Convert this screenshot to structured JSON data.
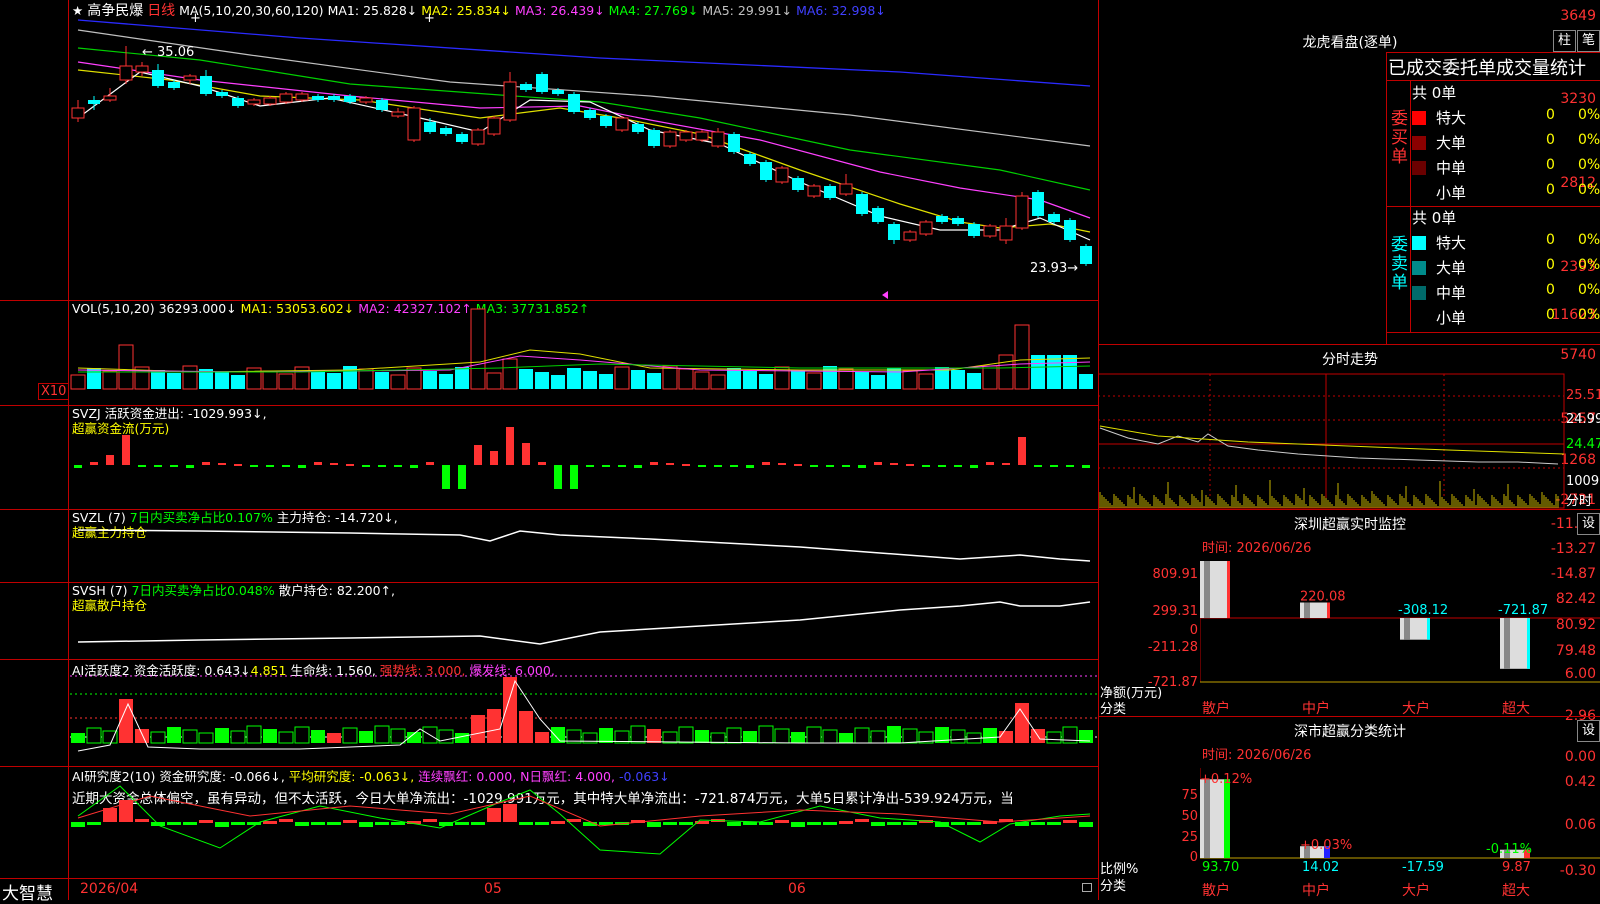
{
  "stock": {
    "star": "★",
    "name": "高争民爆",
    "period": "日线"
  },
  "ma_header": {
    "params": "MA(5,10,20,30,60,120)",
    "ma1_label": "MA1:",
    "ma1": "25.828↓",
    "ma2_label": "MA2:",
    "ma2": "25.834↓",
    "ma3_label": "MA3:",
    "ma3": "26.439↓",
    "ma4_label": "MA4:",
    "ma4": "27.769↓",
    "ma5_label": "MA5:",
    "ma5": "29.991↓",
    "ma6_label": "MA6:",
    "ma6": "32.998↓"
  },
  "price_axis": [
    "3649",
    "3230",
    "2812",
    "2393"
  ],
  "price_marks": {
    "high": "35.06",
    "low": "23.93"
  },
  "vol_header": {
    "params": "VOL(5,10,20)",
    "vol": "36293.000↓",
    "ma1_label": "MA1:",
    "ma1": "53053.602↓",
    "ma2_label": "MA2:",
    "ma2": "42327.102↑",
    "ma3_label": "MA3:",
    "ma3": "37731.852↑"
  },
  "vol_axis": [
    "11623",
    "5740"
  ],
  "vol_unit": "X10",
  "svzj": {
    "name": "SVZJ",
    "label": "活跃资金进出:",
    "value": "-1029.993↓,",
    "subtitle": "超赢资金流(万元)"
  },
  "svzj_axis": [
    "5257",
    "1268",
    "-2721"
  ],
  "svzl": {
    "name": "SVZL",
    "param": "(7)",
    "desc": "7日内买卖净占比0.107%",
    "label": "主力持仓:",
    "value": "-14.720↓,",
    "subtitle": "超赢主力持仓"
  },
  "svzl_axis": [
    "-11.68",
    "-13.27",
    "-14.87"
  ],
  "svsh": {
    "name": "SVSH",
    "param": "(7)",
    "desc": "7日内买卖净占比0.048%",
    "label": "散户持仓:",
    "value": "82.200↑,",
    "subtitle": "超赢散户持仓"
  },
  "svsh_axis": [
    "82.42",
    "80.92",
    "79.48"
  ],
  "ai_active": {
    "name": "AI活跃度2",
    "label": "资金活跃度:",
    "value1": "0.643↓",
    "value2": "4.851",
    "life_label": "生命线:",
    "life": "1.560,",
    "strong_label": "强势线:",
    "strong": "3.000,",
    "burst_label": "爆发线:",
    "burst": "6.000,"
  },
  "ai_active_axis": [
    "6.00",
    "2.96",
    "0.00"
  ],
  "ai_research": {
    "name": "AI研究度2(10)",
    "label": "资金研究度:",
    "value": "-0.066↓,",
    "avg_label": "平均研究度:",
    "avg": "-0.063↓,",
    "red_label": "连续飘红:",
    "red": "0.000,",
    "nred_label": "N日飘红:",
    "nred": "4.000,",
    "last": "-0.063↓"
  },
  "ai_research_axis": [
    "0.42",
    "0.06",
    "-0.30"
  ],
  "commentary": "近期大资金总体偏空，虽有异动，但不太活跃，今日大单净流出：-1029.991万元，其中特大单净流出：-721.874万元，大单5日累计净出-539.924万元，当",
  "date_axis": {
    "brand": "大智慧",
    "d1": "2026/04",
    "d2": "05",
    "d3": "06"
  },
  "right": {
    "dragon_title": "龙虎看盘(逐单)",
    "btn1": "柱",
    "btn2": "笔",
    "table_title": "已成交委托单成交量统计",
    "buy_label": "委买单",
    "sell_label": "委卖单",
    "buy_total": "共 0单",
    "sell_total": "共 0单",
    "buy_rows": [
      {
        "name": "特大",
        "v": "0",
        "p": "0%"
      },
      {
        "name": "大单",
        "v": "0",
        "p": "0%"
      },
      {
        "name": "中单",
        "v": "0",
        "p": "0%"
      },
      {
        "name": "小单",
        "v": "0",
        "p": "0%"
      }
    ],
    "sell_rows": [
      {
        "name": "特大",
        "v": "0",
        "p": "0%"
      },
      {
        "name": "大单",
        "v": "0",
        "p": "0%"
      },
      {
        "name": "中单",
        "v": "0",
        "p": "0%"
      },
      {
        "name": "小单",
        "v": "0",
        "p": "0%"
      }
    ],
    "intraday_title": "分时走势",
    "intraday_axis": [
      "25.51",
      "24.99",
      "24.47",
      "1009"
    ],
    "intraday_time": "分时",
    "monitor_title": "深圳超赢实时监控",
    "monitor_btn": "设",
    "monitor_time": "时间: 2026/06/26",
    "monitor_axis": [
      "809.91",
      "299.31",
      "0",
      "-211.28",
      "-721.87"
    ],
    "monitor_ylabel": "净额(万元)",
    "monitor_xlabel": "分类",
    "monitor_values": [
      "809.91",
      "220.08",
      "-308.12",
      "-721.87"
    ],
    "categories": [
      "散户",
      "中户",
      "大户",
      "超大"
    ],
    "stat_title": "深市超赢分类统计",
    "stat_btn": "设",
    "stat_time": "时间: 2026/06/26",
    "stat_axis": [
      "75",
      "50",
      "25",
      "0"
    ],
    "stat_ylabel": "比例%",
    "stat_xlabel": "分类",
    "stat_pct": [
      "+0.12%",
      "+0.03%",
      "",
      "-0.11%"
    ],
    "stat_values": [
      "93.70",
      "14.02",
      "-17.59",
      "9.87"
    ]
  }
}
